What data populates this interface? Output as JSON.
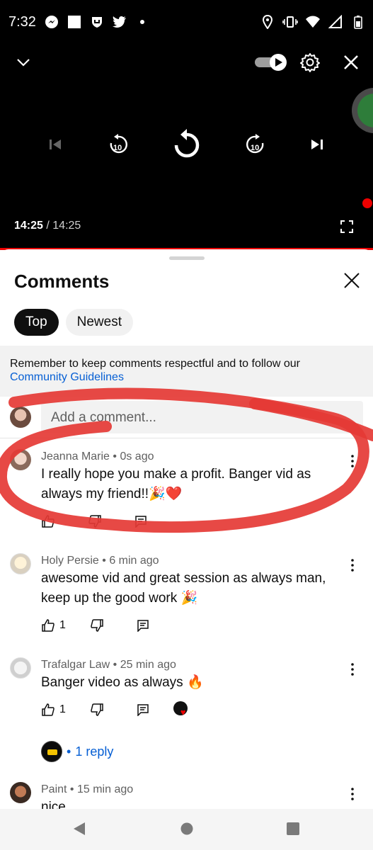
{
  "status_bar": {
    "time": "7:32"
  },
  "player": {
    "current_time": "14:25",
    "separator": "/",
    "duration": "14:25",
    "progress": 1.0,
    "accent": "#ff0000"
  },
  "comments_panel": {
    "title": "Comments",
    "filters": [
      "Top",
      "Newest"
    ],
    "notice_text": "Remember to keep comments respectful and to follow our",
    "notice_link": "Community Guidelines",
    "add_comment_placeholder": "Add a comment..."
  },
  "comments": [
    {
      "author": "Jeanna Marie",
      "age": "0s ago",
      "text": "I really hope you make a profit. Banger vid as always my friend!!🎉❤️",
      "likes": ""
    },
    {
      "author": "Holy Persie",
      "age": "6 min ago",
      "text": "awesome vid and great session as always man, keep up the good work 🎉",
      "likes": "1"
    },
    {
      "author": "Trafalgar Law",
      "age": "25 min ago",
      "text": "Banger video as always 🔥",
      "likes": "1",
      "reply_count": "1 reply"
    },
    {
      "author": "Paint",
      "age": "15 min ago",
      "text": "nice"
    }
  ],
  "meta_separator": " • ",
  "reply_bullet": "•",
  "colors": {
    "link": "#065fd4",
    "annotation": "#e53935"
  }
}
